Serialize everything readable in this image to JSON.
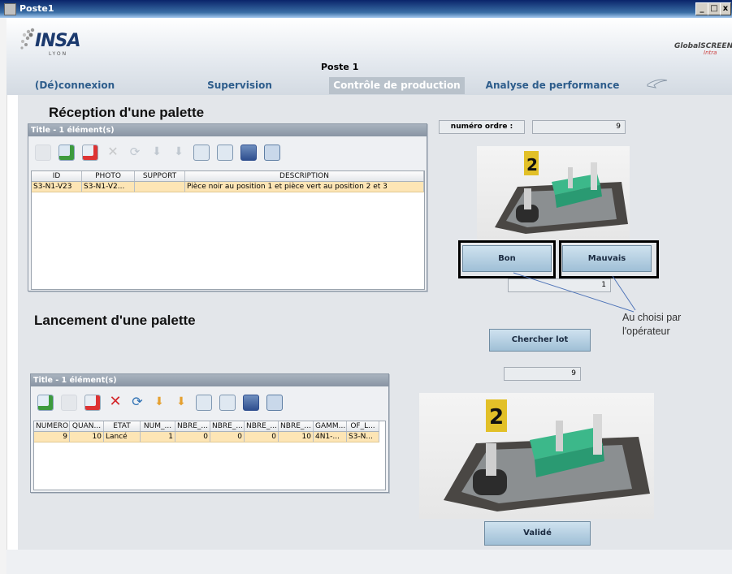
{
  "window": {
    "title": "Poste1",
    "controls": [
      "_",
      "□",
      "x"
    ]
  },
  "header": {
    "logo": "INSA",
    "logo_sub": "LYON",
    "brand": "GlobalSCREEN",
    "brand_sub": "Intra",
    "title": "Poste 1"
  },
  "tabs": [
    {
      "label": "(Dé)connexion"
    },
    {
      "label": "Supervision"
    },
    {
      "label": "Contrôle de production",
      "active": true
    },
    {
      "label": "Analyse de performance"
    }
  ],
  "reception": {
    "heading": "Réception d'une palette",
    "panel_title": "Title - 1 élément(s)",
    "columns": [
      "ID",
      "PHOTO",
      "SUPPORT",
      "DESCRIPTION"
    ],
    "rows": [
      [
        "S3-N1-V23",
        "S3-N1-V2...",
        "",
        "Pièce noir au position 1 et pièce vert au position 2 et 3"
      ]
    ]
  },
  "order": {
    "label": "numéro ordre :",
    "value": "9"
  },
  "quality": {
    "good_label": "Bon",
    "bad_label": "Mauvais",
    "count_value": "1"
  },
  "annotation": {
    "line1": "Au choisi par",
    "line2": "l'opérateur"
  },
  "lancement": {
    "heading": "Lancement d'une palette",
    "panel_title": "Title - 1 élément(s)",
    "columns": [
      "NUMERO",
      "QUAN...",
      "ETAT",
      "NUM_...",
      "NBRE_...",
      "NBRE_...",
      "NBRE_...",
      "NBRE_...",
      "GAMM...",
      "OF_L..."
    ],
    "rows": [
      [
        "9",
        "10",
        "Lancé",
        "1",
        "0",
        "0",
        "0",
        "10",
        "4N1-...",
        "S3-N..."
      ]
    ]
  },
  "search": {
    "button_label": "Chercher lot",
    "value": "9"
  },
  "validate": {
    "button_label": "Validé"
  },
  "photo": {
    "tag_number": "2"
  },
  "colors": {
    "tab_text": "#2e5d8c",
    "active_tab": "#b9c2cb",
    "row_highlight": "#fde5b5",
    "button": "#b7d0e2",
    "panel_title": "#8f9aa8"
  }
}
